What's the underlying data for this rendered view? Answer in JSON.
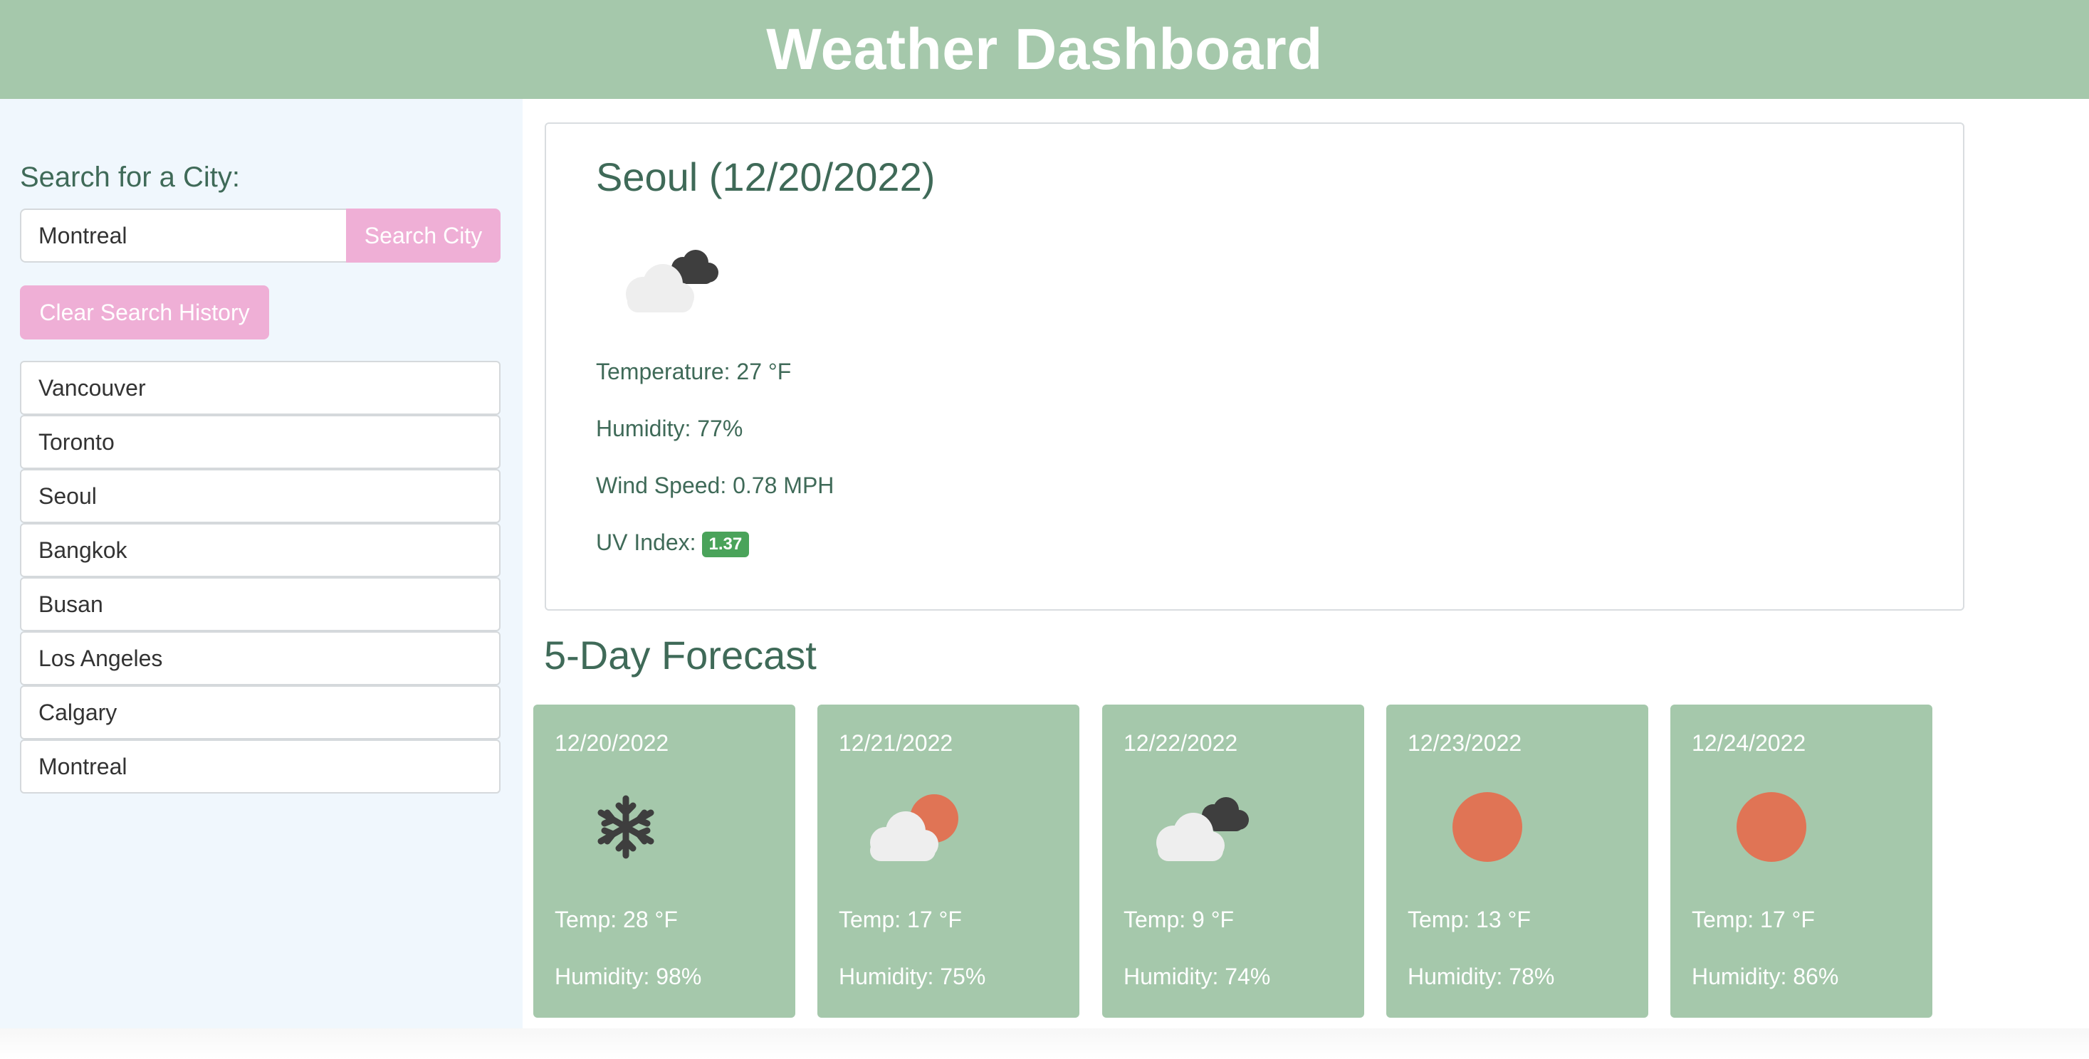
{
  "header": {
    "title": "Weather Dashboard"
  },
  "sidebar": {
    "search_label": "Search for a City:",
    "search_value": "Montreal",
    "search_button": "Search City",
    "clear_button": "Clear Search History",
    "history": [
      "Vancouver",
      "Toronto",
      "Seoul",
      "Bangkok",
      "Busan",
      "Los Angeles",
      "Calgary",
      "Montreal"
    ]
  },
  "current": {
    "title": "Seoul (12/20/2022)",
    "icon": "cloud-dark-cloud-icon",
    "temperature": "Temperature: 27 °F",
    "humidity": "Humidity: 77%",
    "wind": "Wind Speed: 0.78 MPH",
    "uv_label": "UV Index:",
    "uv_value": "1.37",
    "uv_color": "#4aa35a"
  },
  "forecast": {
    "title": "5-Day Forecast",
    "days": [
      {
        "date": "12/20/2022",
        "icon": "snowflake-icon",
        "temp": "Temp: 28 °F",
        "humidity": "Humidity: 98%"
      },
      {
        "date": "12/21/2022",
        "icon": "cloud-sun-icon",
        "temp": "Temp: 17 °F",
        "humidity": "Humidity: 75%"
      },
      {
        "date": "12/22/2022",
        "icon": "cloud-dark-cloud-icon",
        "temp": "Temp: 9 °F",
        "humidity": "Humidity: 74%"
      },
      {
        "date": "12/23/2022",
        "icon": "sun-icon",
        "temp": "Temp: 13 °F",
        "humidity": "Humidity: 78%"
      },
      {
        "date": "12/24/2022",
        "icon": "sun-icon",
        "temp": "Temp: 17 °F",
        "humidity": "Humidity: 86%"
      }
    ]
  },
  "colors": {
    "header": "#a5c8ab",
    "accent_button": "#efafd6",
    "text": "#3f6a58",
    "sun": "#e07455"
  }
}
